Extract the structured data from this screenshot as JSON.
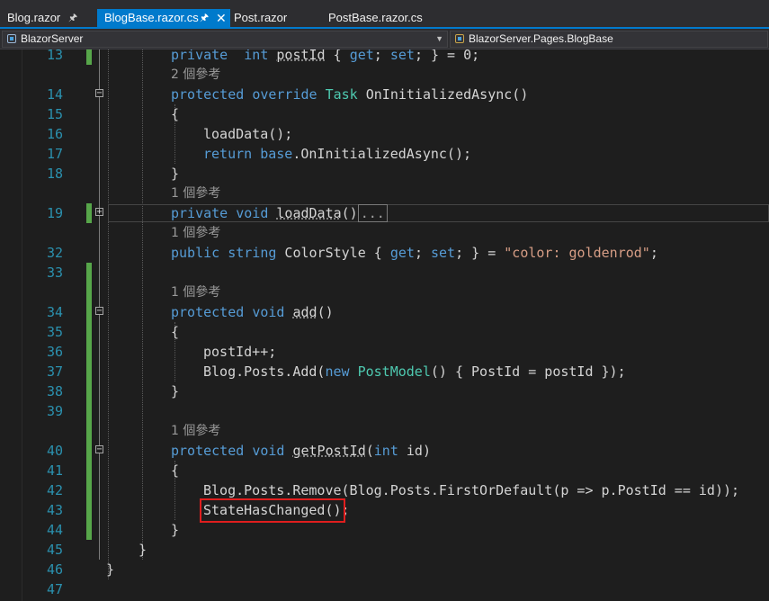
{
  "tabs": [
    {
      "label": "Blog.razor",
      "active": false,
      "pinned": true,
      "closable": false
    },
    {
      "label": "BlogBase.razor.cs",
      "active": true,
      "pinned": true,
      "closable": true
    },
    {
      "label": "Post.razor",
      "active": false,
      "pinned": false,
      "closable": false
    },
    {
      "label": "PostBase.razor.cs",
      "active": false,
      "pinned": false,
      "closable": false
    }
  ],
  "nav": {
    "project": "BlazorServer",
    "class": "BlazorServer.Pages.BlogBase"
  },
  "lines": [
    {
      "num": "13",
      "change": true,
      "indent": 2,
      "tokens": [
        [
          "kw",
          "private"
        ],
        [
          "",
          "  "
        ],
        [
          "kw",
          "int"
        ],
        [
          "",
          " "
        ],
        [
          "sq",
          "postId"
        ],
        [
          "",
          " { "
        ],
        [
          "kw",
          "get"
        ],
        [
          "",
          "; "
        ],
        [
          "kw",
          "set"
        ],
        [
          "",
          "; } = 0;"
        ]
      ]
    },
    {
      "num": "",
      "ref": "2 個參考",
      "indent": 2
    },
    {
      "num": "14",
      "fold": "minus",
      "indent": 2,
      "tokens": [
        [
          "kw",
          "protected"
        ],
        [
          "",
          " "
        ],
        [
          "kw",
          "override"
        ],
        [
          "",
          " "
        ],
        [
          "ty",
          "Task"
        ],
        [
          "",
          " OnInitializedAsync()"
        ]
      ]
    },
    {
      "num": "15",
      "indent": 2,
      "tokens": [
        [
          "",
          "{"
        ]
      ]
    },
    {
      "num": "16",
      "indent": 3,
      "tokens": [
        [
          "",
          "loadData();"
        ]
      ]
    },
    {
      "num": "17",
      "indent": 3,
      "tokens": [
        [
          "kw",
          "return"
        ],
        [
          "",
          " "
        ],
        [
          "kw",
          "base"
        ],
        [
          "",
          ".OnInitializedAsync();"
        ]
      ]
    },
    {
      "num": "18",
      "indent": 2,
      "tokens": [
        [
          "",
          "}"
        ]
      ]
    },
    {
      "num": "",
      "ref": "1 個參考",
      "indent": 2
    },
    {
      "num": "19",
      "change": true,
      "fold": "plus",
      "highlight": true,
      "indent": 2,
      "tokens": [
        [
          "kw",
          "private"
        ],
        [
          "",
          " "
        ],
        [
          "kw",
          "void"
        ],
        [
          "",
          " "
        ],
        [
          "sq",
          "loadData"
        ],
        [
          "",
          "()"
        ],
        [
          "box",
          "..."
        ]
      ]
    },
    {
      "num": "",
      "ref": "1 個參考",
      "indent": 2
    },
    {
      "num": "32",
      "indent": 2,
      "tokens": [
        [
          "kw",
          "public"
        ],
        [
          "",
          " "
        ],
        [
          "kw",
          "string"
        ],
        [
          "",
          " ColorStyle { "
        ],
        [
          "kw",
          "get"
        ],
        [
          "",
          "; "
        ],
        [
          "kw",
          "set"
        ],
        [
          "",
          "; } = "
        ],
        [
          "st",
          "\"color: goldenrod\""
        ],
        [
          "",
          ";"
        ]
      ]
    },
    {
      "num": "33",
      "change": true,
      "indent": 2,
      "tokens": []
    },
    {
      "num": "",
      "ref": "1 個參考",
      "indent": 2,
      "change": true
    },
    {
      "num": "34",
      "change": true,
      "fold": "minus",
      "indent": 2,
      "tokens": [
        [
          "kw",
          "protected"
        ],
        [
          "",
          " "
        ],
        [
          "kw",
          "void"
        ],
        [
          "",
          " "
        ],
        [
          "sq",
          "add"
        ],
        [
          "",
          "()"
        ]
      ]
    },
    {
      "num": "35",
      "change": true,
      "indent": 2,
      "tokens": [
        [
          "",
          "{"
        ]
      ]
    },
    {
      "num": "36",
      "change": true,
      "indent": 3,
      "tokens": [
        [
          "",
          "postId++;"
        ]
      ]
    },
    {
      "num": "37",
      "change": true,
      "indent": 3,
      "tokens": [
        [
          "",
          "Blog.Posts.Add("
        ],
        [
          "kw",
          "new"
        ],
        [
          "",
          " "
        ],
        [
          "ty",
          "PostModel"
        ],
        [
          "",
          "() { PostId = postId });"
        ]
      ]
    },
    {
      "num": "38",
      "change": true,
      "indent": 2,
      "tokens": [
        [
          "",
          "}"
        ]
      ]
    },
    {
      "num": "39",
      "change": true,
      "indent": 2,
      "tokens": []
    },
    {
      "num": "",
      "ref": "1 個參考",
      "indent": 2,
      "change": true
    },
    {
      "num": "40",
      "change": true,
      "fold": "minus",
      "indent": 2,
      "tokens": [
        [
          "kw",
          "protected"
        ],
        [
          "",
          " "
        ],
        [
          "kw",
          "void"
        ],
        [
          "",
          " "
        ],
        [
          "sq",
          "getPostId"
        ],
        [
          "",
          "("
        ],
        [
          "kw",
          "int"
        ],
        [
          "",
          " id)"
        ]
      ]
    },
    {
      "num": "41",
      "change": true,
      "indent": 2,
      "tokens": [
        [
          "",
          "{"
        ]
      ]
    },
    {
      "num": "42",
      "change": true,
      "indent": 3,
      "tokens": [
        [
          "",
          "Blog.Posts.Remove(Blog.Posts.FirstOrDefault(p => p.PostId == id));"
        ]
      ]
    },
    {
      "num": "43",
      "change": true,
      "indent": 3,
      "redbox": true,
      "tokens": [
        [
          "",
          "StateHasChanged();"
        ]
      ]
    },
    {
      "num": "44",
      "change": true,
      "indent": 2,
      "tokens": [
        [
          "",
          "}"
        ]
      ]
    },
    {
      "num": "45",
      "indent": 1,
      "tokens": [
        [
          "",
          "}"
        ]
      ]
    },
    {
      "num": "46",
      "indent": 0,
      "tokens": [
        [
          "",
          "}"
        ]
      ]
    },
    {
      "num": "47",
      "indent": 0,
      "tokens": []
    }
  ],
  "colors": {
    "keyword": "#569cd6",
    "type": "#4ec9b0",
    "string": "#d69d85",
    "line_number": "#2b91af",
    "change_bar": "#57a64a",
    "highlight_box": "#e01e1e",
    "active_tab": "#007acc"
  }
}
